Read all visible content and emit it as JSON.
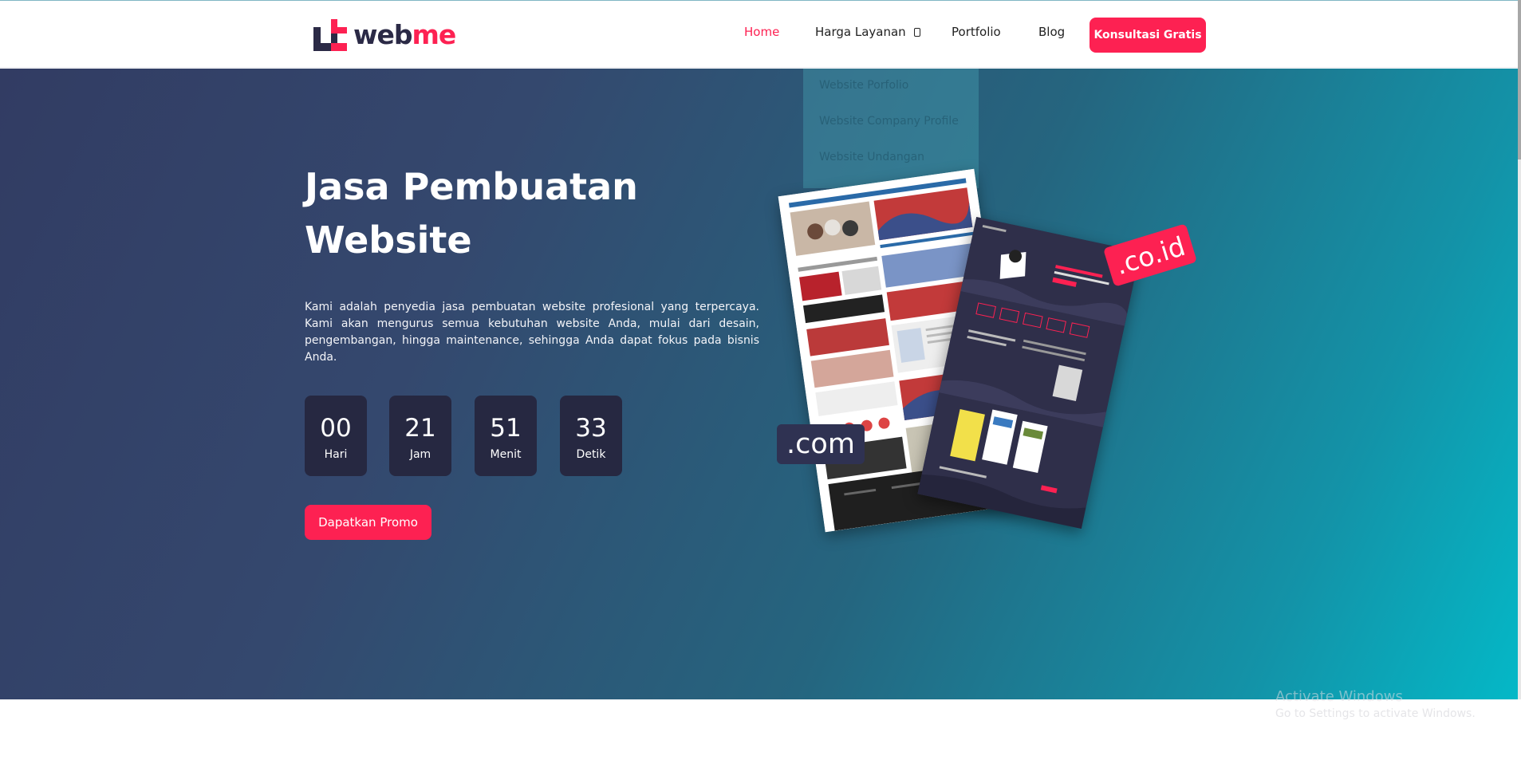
{
  "brand": {
    "logo_text_dark": "web",
    "logo_text_accent": "me",
    "accent_color": "#fd2152",
    "dark_color": "#2b2a46"
  },
  "nav": {
    "items": [
      {
        "label": "Home",
        "active": true
      },
      {
        "label": "Harga Layanan",
        "has_dropdown": true
      },
      {
        "label": "Portfolio"
      },
      {
        "label": "Blog"
      }
    ],
    "cta_label": "Konsultasi Gratis"
  },
  "dropdown": {
    "items": [
      "Website Porfolio",
      "Website Company Profile",
      "Website Undangan"
    ]
  },
  "hero": {
    "title_line1": "Jasa Pembuatan",
    "title_line2": "Website",
    "description": "Kami  adalah penyedia jasa pembuatan website profesional yang terpercaya. Kami akan mengurus semua kebutuhan website Anda, mulai dari desain, pengembangan, hingga maintenance, sehingga Anda dapat fokus pada bisnis Anda.",
    "countdown": [
      {
        "value": "00",
        "label": "Hari"
      },
      {
        "value": "21",
        "label": "Jam"
      },
      {
        "value": "51",
        "label": "Menit"
      },
      {
        "value": "33",
        "label": "Detik"
      }
    ],
    "promo_label": "Dapatkan Promo",
    "tag_id": ".co.id",
    "tag_com": ".com"
  },
  "watermark": {
    "line1": "Activate Windows",
    "line2": "Go to Settings to activate Windows."
  }
}
